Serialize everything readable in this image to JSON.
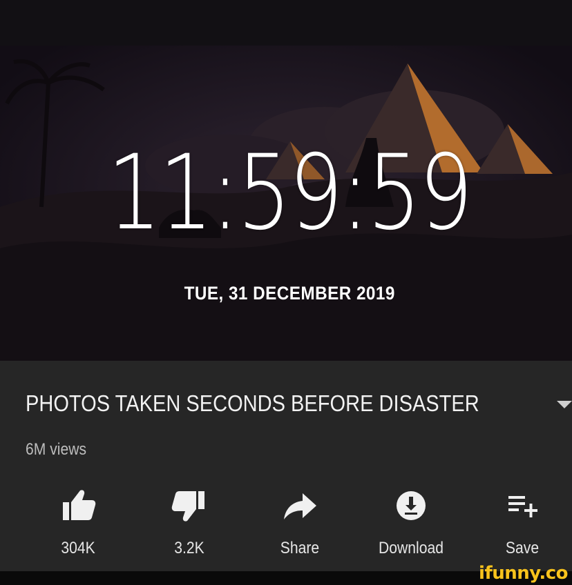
{
  "video": {
    "time": "11:59:59",
    "date": "TUE, 31 DECEMBER 2019"
  },
  "info": {
    "title": "PHOTOS TAKEN SECONDS BEFORE DISASTER",
    "views": "6M views"
  },
  "actions": [
    {
      "icon": "thumbs-up-icon",
      "label": "304K"
    },
    {
      "icon": "thumbs-down-icon",
      "label": "3.2K"
    },
    {
      "icon": "share-icon",
      "label": "Share"
    },
    {
      "icon": "download-icon",
      "label": "Download"
    },
    {
      "icon": "save-playlist-icon",
      "label": "Save"
    }
  ],
  "watermark": "ifunny.co",
  "colors": {
    "panel": "#262626",
    "video_bg": "#0f0b12",
    "pyramid": "#c8782e",
    "watermark": "#f7c21c"
  }
}
